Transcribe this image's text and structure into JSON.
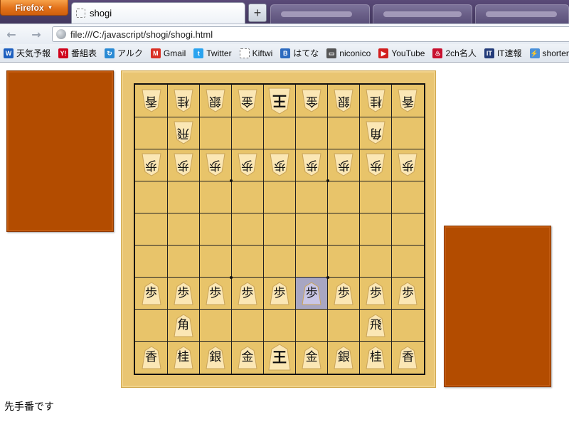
{
  "browser": {
    "app_button": "Firefox",
    "tab_title": "shogi",
    "new_tab_label": "+",
    "url": "file:///C:/javascript/shogi/shogi.html",
    "bookmarks": [
      {
        "label": "天気予報",
        "icon": "weather-icon",
        "glyph": "W",
        "color": "#1d5fbf"
      },
      {
        "label": "番組表",
        "icon": "yahoo-icon",
        "glyph": "Y!",
        "color": "#d0021b"
      },
      {
        "label": "アルク",
        "icon": "alc-icon",
        "glyph": "↻",
        "color": "#2a8ad4"
      },
      {
        "label": "Gmail",
        "icon": "gmail-icon",
        "glyph": "M",
        "color": "#d93025"
      },
      {
        "label": "Twitter",
        "icon": "twitter-icon",
        "glyph": "t",
        "color": "#2aa3ef"
      },
      {
        "label": "Kiftwi",
        "icon": "kiftwi-icon",
        "glyph": "",
        "color": "#ffffff"
      },
      {
        "label": "はてな",
        "icon": "hatena-icon",
        "glyph": "B",
        "color": "#2d6bbf"
      },
      {
        "label": "niconico",
        "icon": "niconico-icon",
        "glyph": "▭",
        "color": "#555555"
      },
      {
        "label": "YouTube",
        "icon": "youtube-icon",
        "glyph": "▶",
        "color": "#d21f1f"
      },
      {
        "label": "2ch名人",
        "icon": "2ch-icon",
        "glyph": "♨",
        "color": "#c8102e"
      },
      {
        "label": "IT速報",
        "icon": "it-icon",
        "glyph": "IT",
        "color": "#243c7a"
      },
      {
        "label": "shortenin",
        "icon": "shortener-icon",
        "glyph": "⚡",
        "color": "#4a90d9"
      }
    ]
  },
  "board": {
    "size": 9,
    "selected": {
      "row": 6,
      "col": 5
    },
    "pieces": [
      {
        "row": 0,
        "col": 0,
        "kanji": "香",
        "side": "gote"
      },
      {
        "row": 0,
        "col": 1,
        "kanji": "桂",
        "side": "gote"
      },
      {
        "row": 0,
        "col": 2,
        "kanji": "銀",
        "side": "gote"
      },
      {
        "row": 0,
        "col": 3,
        "kanji": "金",
        "side": "gote"
      },
      {
        "row": 0,
        "col": 4,
        "kanji": "王",
        "side": "gote"
      },
      {
        "row": 0,
        "col": 5,
        "kanji": "金",
        "side": "gote"
      },
      {
        "row": 0,
        "col": 6,
        "kanji": "銀",
        "side": "gote"
      },
      {
        "row": 0,
        "col": 7,
        "kanji": "桂",
        "side": "gote"
      },
      {
        "row": 0,
        "col": 8,
        "kanji": "香",
        "side": "gote"
      },
      {
        "row": 1,
        "col": 1,
        "kanji": "飛",
        "side": "gote"
      },
      {
        "row": 1,
        "col": 7,
        "kanji": "角",
        "side": "gote"
      },
      {
        "row": 2,
        "col": 0,
        "kanji": "歩",
        "side": "gote"
      },
      {
        "row": 2,
        "col": 1,
        "kanji": "歩",
        "side": "gote"
      },
      {
        "row": 2,
        "col": 2,
        "kanji": "歩",
        "side": "gote"
      },
      {
        "row": 2,
        "col": 3,
        "kanji": "歩",
        "side": "gote"
      },
      {
        "row": 2,
        "col": 4,
        "kanji": "歩",
        "side": "gote"
      },
      {
        "row": 2,
        "col": 5,
        "kanji": "歩",
        "side": "gote"
      },
      {
        "row": 2,
        "col": 6,
        "kanji": "歩",
        "side": "gote"
      },
      {
        "row": 2,
        "col": 7,
        "kanji": "歩",
        "side": "gote"
      },
      {
        "row": 2,
        "col": 8,
        "kanji": "歩",
        "side": "gote"
      },
      {
        "row": 6,
        "col": 0,
        "kanji": "歩",
        "side": "sente"
      },
      {
        "row": 6,
        "col": 1,
        "kanji": "歩",
        "side": "sente"
      },
      {
        "row": 6,
        "col": 2,
        "kanji": "歩",
        "side": "sente"
      },
      {
        "row": 6,
        "col": 3,
        "kanji": "歩",
        "side": "sente"
      },
      {
        "row": 6,
        "col": 4,
        "kanji": "歩",
        "side": "sente"
      },
      {
        "row": 6,
        "col": 5,
        "kanji": "歩",
        "side": "sente"
      },
      {
        "row": 6,
        "col": 6,
        "kanji": "歩",
        "side": "sente"
      },
      {
        "row": 6,
        "col": 7,
        "kanji": "歩",
        "side": "sente"
      },
      {
        "row": 6,
        "col": 8,
        "kanji": "歩",
        "side": "sente"
      },
      {
        "row": 7,
        "col": 1,
        "kanji": "角",
        "side": "sente"
      },
      {
        "row": 7,
        "col": 7,
        "kanji": "飛",
        "side": "sente"
      },
      {
        "row": 8,
        "col": 0,
        "kanji": "香",
        "side": "sente"
      },
      {
        "row": 8,
        "col": 1,
        "kanji": "桂",
        "side": "sente"
      },
      {
        "row": 8,
        "col": 2,
        "kanji": "銀",
        "side": "sente"
      },
      {
        "row": 8,
        "col": 3,
        "kanji": "金",
        "side": "sente"
      },
      {
        "row": 8,
        "col": 4,
        "kanji": "王",
        "side": "sente"
      },
      {
        "row": 8,
        "col": 5,
        "kanji": "金",
        "side": "sente"
      },
      {
        "row": 8,
        "col": 6,
        "kanji": "銀",
        "side": "sente"
      },
      {
        "row": 8,
        "col": 7,
        "kanji": "桂",
        "side": "sente"
      },
      {
        "row": 8,
        "col": 8,
        "kanji": "香",
        "side": "sente"
      }
    ]
  },
  "status_text": "先手番です",
  "colors": {
    "board": "#e8c46a",
    "stand": "#b34c00",
    "selected_cell": "#a8a6c2",
    "piece_fill": "#fbe7b5"
  }
}
